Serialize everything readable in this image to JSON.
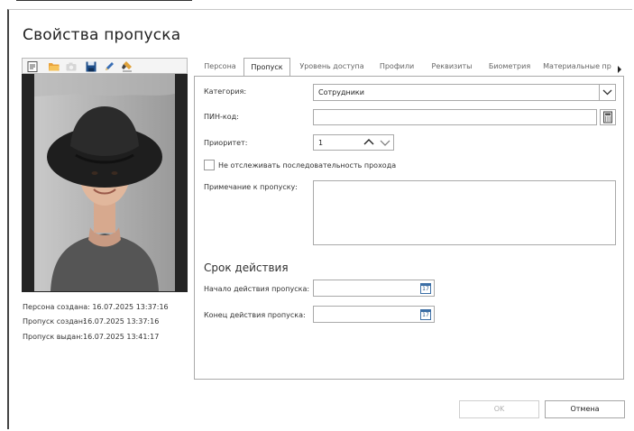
{
  "window": {
    "title": "Свойства пропуска"
  },
  "toolbar": {
    "icons": [
      "scan-icon",
      "open-folder-icon",
      "camera-icon",
      "save-icon",
      "edit-icon",
      "erase-icon"
    ]
  },
  "person_info": {
    "created_label": "Персона создана:",
    "created_value": "16.07.2025 13:37:16",
    "pass_created_label": "Пропуск создан:",
    "pass_created_value": "16.07.2025 13:37:16",
    "pass_issued_label": "Пропуск выдан:",
    "pass_issued_value": "16.07.2025 13:41:17"
  },
  "tabs": [
    {
      "label": "Персона"
    },
    {
      "label": "Пропуск"
    },
    {
      "label": "Уровень доступа"
    },
    {
      "label": "Профили"
    },
    {
      "label": "Реквизиты"
    },
    {
      "label": "Биометрия"
    },
    {
      "label": "Материальные пр"
    }
  ],
  "active_tab": "Пропуск",
  "form": {
    "category_label": "Категория:",
    "category_value": "Сотрудники",
    "pin_label": "ПИН-код:",
    "pin_value": "",
    "priority_label": "Приоритет:",
    "priority_value": "1",
    "no_track_label": "Не отслеживать последовательность прохода",
    "no_track_checked": false,
    "note_label": "Примечание к пропуску:",
    "note_value": ""
  },
  "validity": {
    "section_title": "Срок действия",
    "start_label": "Начало действия пропуска:",
    "start_value": "",
    "end_label": "Конец действия пропуска:",
    "end_value": "",
    "calendar_day": "17"
  },
  "buttons": {
    "ok": "OK",
    "cancel": "Отмена"
  }
}
